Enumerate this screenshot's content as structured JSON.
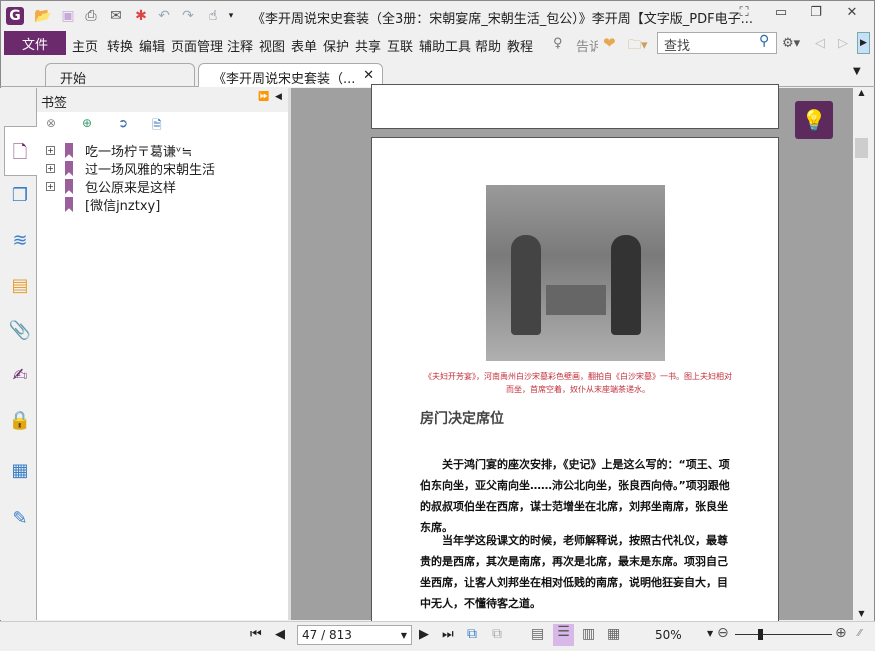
{
  "window": {
    "title": "《李开周说宋史套装（全3册：宋朝宴席_宋朝生活_包公）》李开周【文字版_PDF电子...",
    "controls": [
      "⛶",
      "▭",
      "❐",
      "✕"
    ]
  },
  "menu": {
    "file": "文件",
    "items": [
      "主页",
      "转换",
      "编辑",
      "页面管理",
      "注释",
      "视图",
      "表单",
      "保护",
      "共享",
      "互联",
      "辅助工具",
      "帮助",
      "教程"
    ],
    "tell": "告诉",
    "search_placeholder": "查找"
  },
  "tabs": [
    {
      "label": "开始"
    },
    {
      "label": "《李开周说宋史套装（..."
    }
  ],
  "panel": {
    "title": "书签",
    "bookmarks": [
      "吃一场柠〒葛谦ᵛ≒",
      "过一场风雅的宋朝生活",
      "包公原来是这样",
      "[微信jnztxy]"
    ]
  },
  "page": {
    "caption": "《夫妇开芳宴》，河南禹州白沙宋墓彩色壁画，翻拍自《白沙宋墓》一书。图上夫妇相对而坐，首席空着，奴仆从末座端茶递水。",
    "heading": "房门决定席位",
    "paragraphs": [
      "关于鸿门宴的座次安排，《史记》上是这么写的：“项王、项伯东向坐，亚父南向坐……沛公北向坐，张良西向侍。”项羽跟他的叔叔项伯坐在西席，谋士范增坐在北席，刘邦坐南席，张良坐东席。",
      "当年学这段课文的时候，老师解释说，按照古代礼仪，最尊贵的是西席，其次是南席，再次是北席，最末是东席。项羽自己坐西席，让客人刘邦坐在相对低贱的南席，说明他狂妄自大，目中无人，不懂待客之道。"
    ]
  },
  "status": {
    "page": "47 / 813",
    "zoom": "50%",
    "zoom_fraction": 0.25
  },
  "colors": {
    "accent": "#6b2a6b",
    "caption": "#c0303a"
  }
}
